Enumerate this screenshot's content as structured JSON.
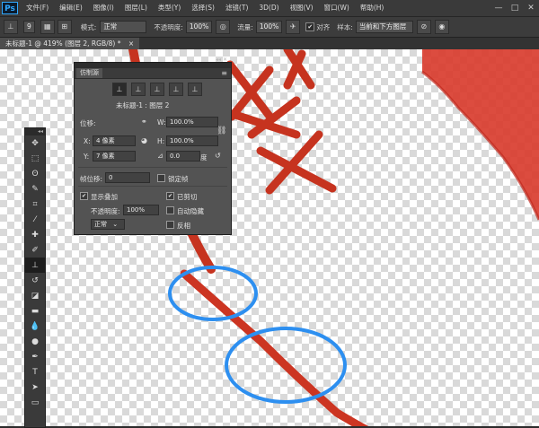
{
  "app": {
    "logo": "Ps"
  },
  "menubar": {
    "items": [
      "文件(F)",
      "编辑(E)",
      "图像(I)",
      "图层(L)",
      "类型(Y)",
      "选择(S)",
      "滤镜(T)",
      "3D(D)",
      "视图(V)",
      "窗口(W)",
      "帮助(H)"
    ]
  },
  "window_controls": [
    "—",
    "□",
    "✕"
  ],
  "options": {
    "brush_size": "9",
    "mode_label": "模式:",
    "mode_value": "正常",
    "opacity_label": "不透明度:",
    "opacity_value": "100%",
    "flow_label": "流量:",
    "flow_value": "100%",
    "aligned_label": "对齐",
    "sample_label": "样本:",
    "sample_value": "当前和下方图层"
  },
  "doc_tab": {
    "title": "未标题-1 @ 419% (图层 2, RGB/8) *",
    "close": "×"
  },
  "toolbar": {
    "tools": [
      {
        "name": "move-tool-icon",
        "glyph": "✥"
      },
      {
        "name": "marquee-tool-icon",
        "glyph": "⬚"
      },
      {
        "name": "lasso-tool-icon",
        "glyph": "ʘ"
      },
      {
        "name": "quick-select-tool-icon",
        "glyph": "✎"
      },
      {
        "name": "crop-tool-icon",
        "glyph": "⌗"
      },
      {
        "name": "eyedropper-tool-icon",
        "glyph": "⁄"
      },
      {
        "name": "healing-brush-tool-icon",
        "glyph": "✚"
      },
      {
        "name": "brush-tool-icon",
        "glyph": "✐"
      },
      {
        "name": "clone-stamp-tool-icon",
        "glyph": "⊥"
      },
      {
        "name": "history-brush-tool-icon",
        "glyph": "↺"
      },
      {
        "name": "eraser-tool-icon",
        "glyph": "◪"
      },
      {
        "name": "gradient-tool-icon",
        "glyph": "▬"
      },
      {
        "name": "blur-tool-icon",
        "glyph": "💧"
      },
      {
        "name": "dodge-tool-icon",
        "glyph": "●"
      },
      {
        "name": "pen-tool-icon",
        "glyph": "✒"
      },
      {
        "name": "type-tool-icon",
        "glyph": "T"
      },
      {
        "name": "path-select-tool-icon",
        "glyph": "➤"
      },
      {
        "name": "shape-tool-icon",
        "glyph": "▭"
      }
    ]
  },
  "clone_panel": {
    "tab": "仿制源",
    "menu_glyph": "≡",
    "close_glyph": "◂◂ ✕",
    "source_name": "未标题-1 : 图层 2",
    "offset_label": "位移:",
    "w_label": "W:",
    "w_value": "100.0%",
    "h_label": "H:",
    "h_value": "100.0%",
    "x_label": "X:",
    "x_value": "4 像素",
    "y_label": "Y:",
    "y_value": "7 像素",
    "angle_value": "0.0",
    "angle_unit": "度",
    "frame_offset_label": "帧位移:",
    "frame_offset_value": "0",
    "lock_frame_label": "锁定帧",
    "show_overlay_label": "显示叠加",
    "opacity_label": "不透明度:",
    "opacity_value": "100%",
    "blend_value": "正常",
    "clipped_label": "已剪切",
    "auto_hide_label": "自动隐藏",
    "invert_label": "反相"
  }
}
